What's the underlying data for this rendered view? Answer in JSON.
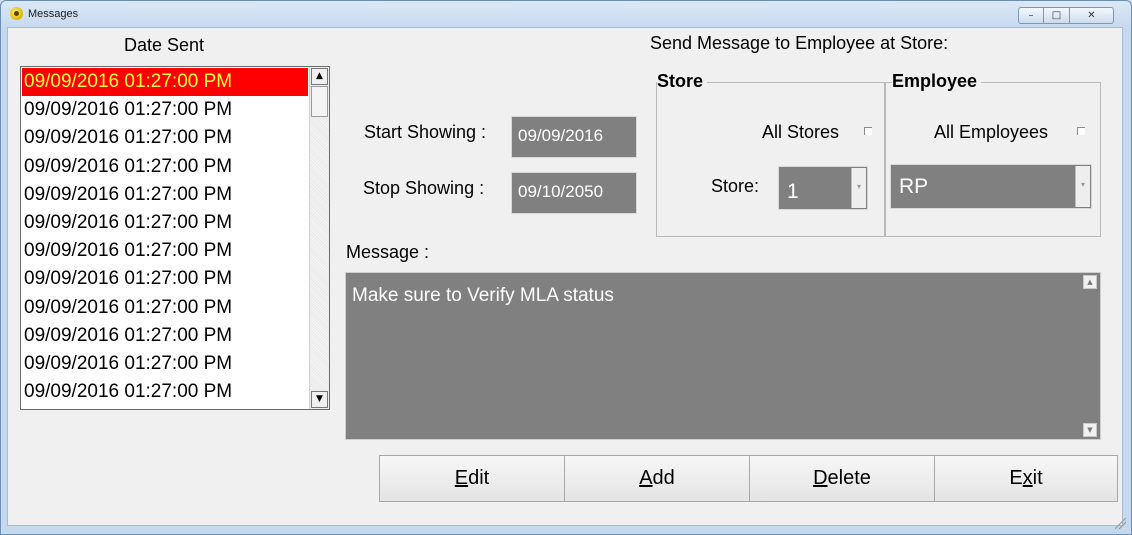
{
  "window": {
    "title": "Messages",
    "controls": {
      "minimize": "–",
      "maximize": "□",
      "close": "✕"
    }
  },
  "date_list": {
    "header": "Date Sent",
    "items": [
      "09/09/2016 01:27:00 PM",
      "09/09/2016 01:27:00 PM",
      "09/09/2016 01:27:00 PM",
      "09/09/2016 01:27:00 PM",
      "09/09/2016 01:27:00 PM",
      "09/09/2016 01:27:00 PM",
      "09/09/2016 01:27:00 PM",
      "09/09/2016 01:27:00 PM",
      "09/09/2016 01:27:00 PM",
      "09/09/2016 01:27:00 PM",
      "09/09/2016 01:27:00 PM",
      "09/09/2016 01:27:00 PM"
    ],
    "selected_index": 0,
    "scroll_up": "▲",
    "scroll_down": "▼"
  },
  "schedule": {
    "start_label": "Start Showing :",
    "start_value": "09/09/2016",
    "stop_label": "Stop Showing :",
    "stop_value": "09/10/2050"
  },
  "send": {
    "title": "Send Message to Employee at Store:",
    "store_group": {
      "title": "Store",
      "all_label": "All Stores",
      "all_checked": false,
      "store_label": "Store:",
      "store_value": "1"
    },
    "employee_group": {
      "title": "Employee",
      "all_label": "All Employees",
      "all_checked": false,
      "employee_value": "RP"
    }
  },
  "message": {
    "label": "Message :",
    "text": "Make sure to Verify MLA status"
  },
  "buttons": {
    "edit": "Edit",
    "add": "Add",
    "delete": "Delete",
    "exit": "Exit"
  },
  "colors": {
    "selected_bg": "#ff0000",
    "selected_text": "#ffff3a",
    "field_bg": "#808080"
  }
}
